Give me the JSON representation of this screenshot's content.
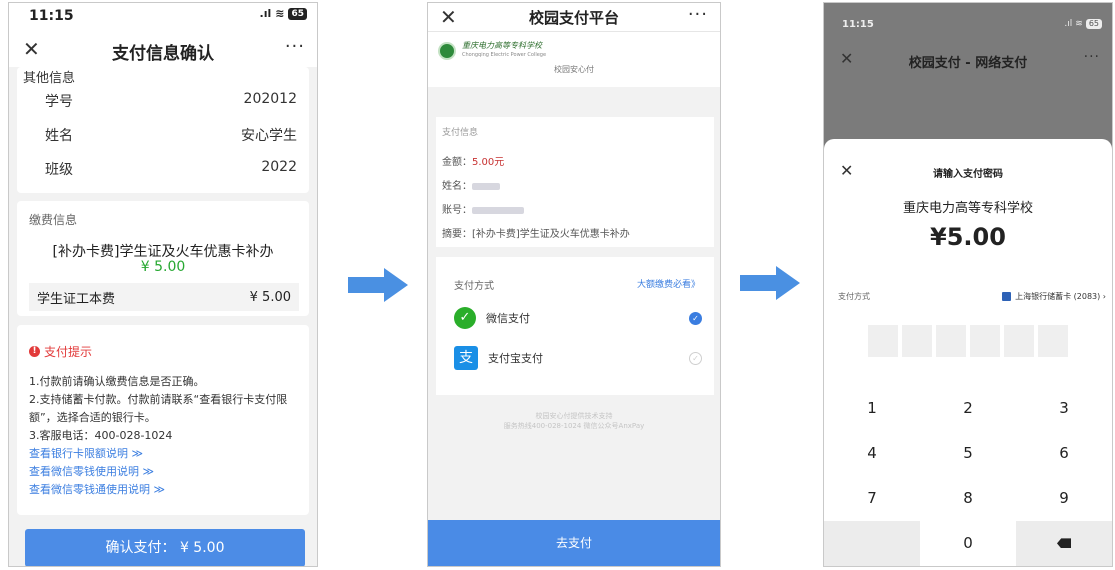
{
  "colors": {
    "accent_blue": "#4c8ce6",
    "arrow_blue": "#4a90e2",
    "green_amount": "#27a832",
    "red_tip": "#e23a3a",
    "wechat_green": "#2aae2a",
    "alipay_blue": "#1a8fe6"
  },
  "screen1": {
    "status_time": "11:15",
    "battery": "65",
    "nav": {
      "close_icon": "close-icon",
      "title": "支付信息确认",
      "more": "···"
    },
    "info": {
      "section_title": "其他信息",
      "rows": [
        {
          "label": "学号",
          "value": "202012"
        },
        {
          "label": "姓名",
          "value": "安心学生"
        },
        {
          "label": "班级",
          "value": "2022"
        }
      ]
    },
    "fee": {
      "section_title": "缴费信息",
      "item_name": "[补办卡费]学生证及火车优惠卡补办",
      "item_amount": "¥ 5.00",
      "row_label": "学生证工本费",
      "row_value": "¥ 5.00"
    },
    "tips": {
      "title": "支付提示",
      "lines": [
        "1.付款前请确认缴费信息是否正确。",
        "2.支持储蓄卡付款。付款前请联系“查看银行卡支付限额”，选择合适的银行卡。",
        "3.客服电话：400-028-1024"
      ],
      "links": [
        "查看银行卡限额说明 ≫",
        "查看微信零钱使用说明 ≫",
        "查看微信零钱通使用说明 ≫"
      ]
    },
    "confirm_button": "确认支付： ¥ 5.00"
  },
  "screen2": {
    "nav": {
      "title": "校园支付平台",
      "more": "···"
    },
    "logo_cn": "重庆电力高等专科学校",
    "logo_en": "Chongqing Electric Power College",
    "header_sub": "校园安心付",
    "info": {
      "section_title": "支付信息",
      "amount_label": "金额：",
      "amount_value": "5.00元",
      "name_label": "姓名：",
      "account_label": "账号：",
      "summary_label": "摘要：",
      "summary_value": "[补办卡费]学生证及火车优惠卡补办"
    },
    "pay": {
      "method_label": "支付方式",
      "limit_link": "大额缴费必看》",
      "options": [
        {
          "icon": "wechat-icon",
          "label": "微信支付",
          "selected": true
        },
        {
          "icon": "alipay-icon",
          "label": "支付宝支付",
          "selected": false
        }
      ]
    },
    "footer_line1": "校园安心付提供技术支持",
    "footer_line2": "服务热线400-028-1024 微信公众号AnxPay",
    "button": "去支付"
  },
  "screen3": {
    "status_time": "11:15",
    "battery": "65",
    "nav": {
      "title": "校园支付 - 网络支付",
      "more": "···"
    },
    "sheet": {
      "title": "请输入支付密码",
      "school": "重庆电力高等专科学校",
      "amount": "¥5.00",
      "method_label": "支付方式",
      "bank": "上海银行储蓄卡 (2083) ›"
    },
    "keys": [
      "1",
      "2",
      "3",
      "4",
      "5",
      "6",
      "7",
      "8",
      "9",
      "",
      "0",
      ""
    ]
  }
}
